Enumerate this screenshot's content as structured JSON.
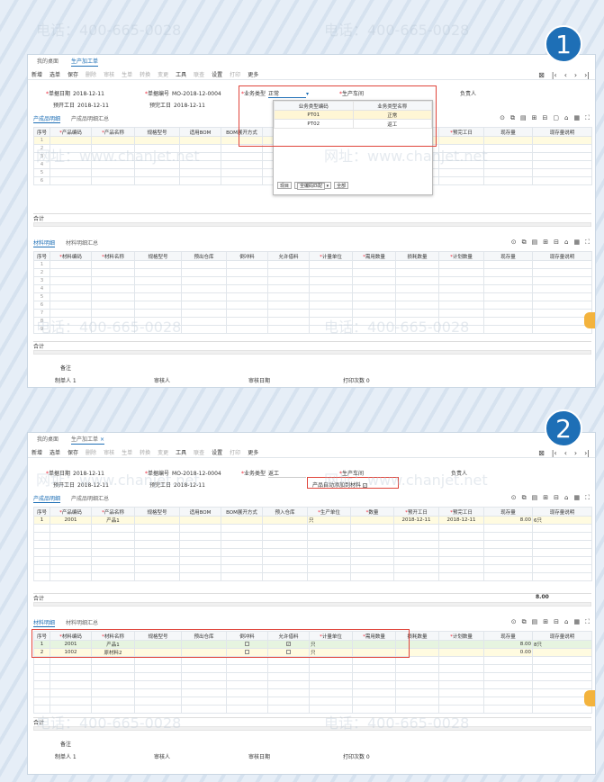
{
  "badges": [
    "1",
    "2"
  ],
  "tabs": [
    "我的桌面",
    "生产加工单"
  ],
  "toolbar": [
    "新增",
    "选单",
    "保存",
    "删除",
    "审核",
    "生单",
    "转换",
    "变更",
    "工具",
    "联查",
    "设置",
    "打印",
    "更多"
  ],
  "header": {
    "date_label": "单据日期",
    "date": "2018-12-11",
    "code_label": "单据编号",
    "code": "MO-2018-12-0004",
    "type_label": "业务类型",
    "type_p1": "正常",
    "type_p2": "返工",
    "workshop_label": "生产车间",
    "owner_label": "负责人",
    "start_label": "预开工日",
    "start": "2018-12-11",
    "end_label": "预完工日",
    "end": "2018-12-11",
    "auto_label": "产品自动添加到材料"
  },
  "product_tabs": [
    "产成品明细",
    "产成品明细汇总"
  ],
  "material_tabs": [
    "材料明细",
    "材料明细汇总"
  ],
  "product_cols": [
    "序号",
    "产品编码",
    "产品名称",
    "规格型号",
    "适用BOM",
    "BOM展开方式",
    "预入仓库",
    "生产单位",
    "数量",
    "预开工日",
    "预完工日",
    "现存量",
    "现存量说明"
  ],
  "product_row": {
    "no": "1",
    "code": "2001",
    "name": "产品1",
    "unit": "只",
    "start": "2018-12-11",
    "end": "2018-12-11",
    "stock": "8.00",
    "note": "6只"
  },
  "material_cols": [
    "序号",
    "材料编码",
    "材料名称",
    "规格型号",
    "预出仓库",
    "倒冲料",
    "允许借料",
    "计量单位",
    "需用数量",
    "损耗数量",
    "计划数量",
    "现存量",
    "现存量说明"
  ],
  "material_rows": [
    {
      "no": "1",
      "code": "2001",
      "name": "产品1",
      "unit": "只",
      "stock": "8.00",
      "note": "8只"
    },
    {
      "no": "2",
      "code": "1002",
      "name": "原材料2",
      "unit": "只",
      "stock": "0.00",
      "note": ""
    }
  ],
  "total_label": "合计",
  "total_value": "8.00",
  "popup": {
    "col1": "业务类型编码",
    "col2": "业务类型名称",
    "rows": [
      {
        "code": "PT01",
        "name": "正常"
      },
      {
        "code": "PT02",
        "name": "返工"
      }
    ],
    "btns": [
      "现目",
      "全编码匹配",
      "全部"
    ]
  },
  "footer": {
    "note": "备注",
    "maker": "制单人 1",
    "auditor": "审核人",
    "audit_date": "审核日期",
    "print": "打印次数 0"
  },
  "watermarks": [
    "电话：400-665-0028",
    "网址：www.chanjet.net"
  ]
}
